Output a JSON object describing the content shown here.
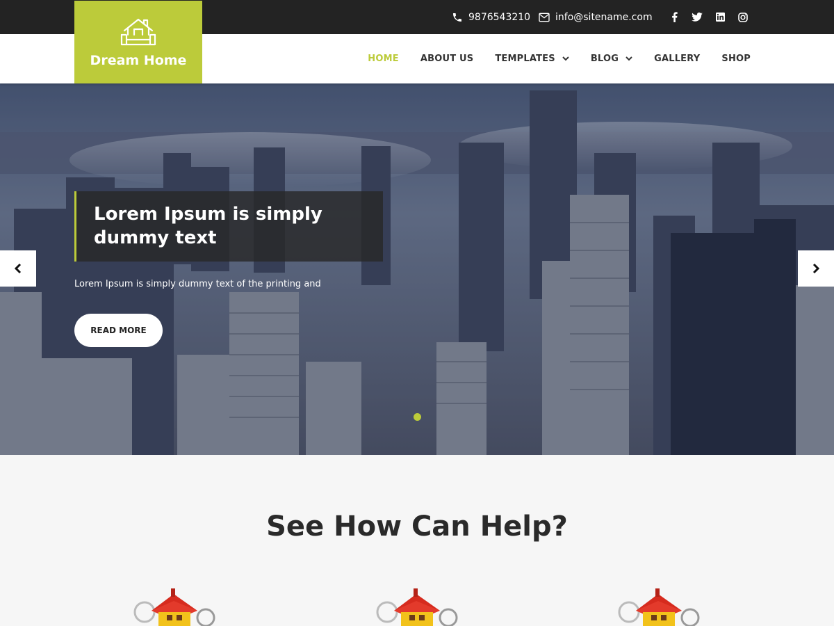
{
  "topbar": {
    "phone": "9876543210",
    "email": "info@sitename.com",
    "social_icons": [
      "facebook-icon",
      "twitter-icon",
      "linkedin-icon",
      "instagram-icon"
    ]
  },
  "logo": {
    "text": "Dream Home",
    "icon": "house-icon"
  },
  "nav": {
    "items": [
      {
        "label": "HOME",
        "active": true
      },
      {
        "label": "ABOUT US"
      },
      {
        "label": "TEMPLATES",
        "dropdown": true
      },
      {
        "label": "BLOG",
        "dropdown": true
      },
      {
        "label": "GALLERY"
      },
      {
        "label": "SHOP"
      }
    ]
  },
  "hero": {
    "title_line1": "Lorem Ipsum is simply",
    "title_line2": "dummy text",
    "description": "Lorem Ipsum is simply dummy text of the printing and",
    "button_label": "READ MORE",
    "slide_count": 1
  },
  "services": {
    "title": "See How Can Help?"
  },
  "colors": {
    "accent": "#bccb3a",
    "topbar": "#232323"
  }
}
